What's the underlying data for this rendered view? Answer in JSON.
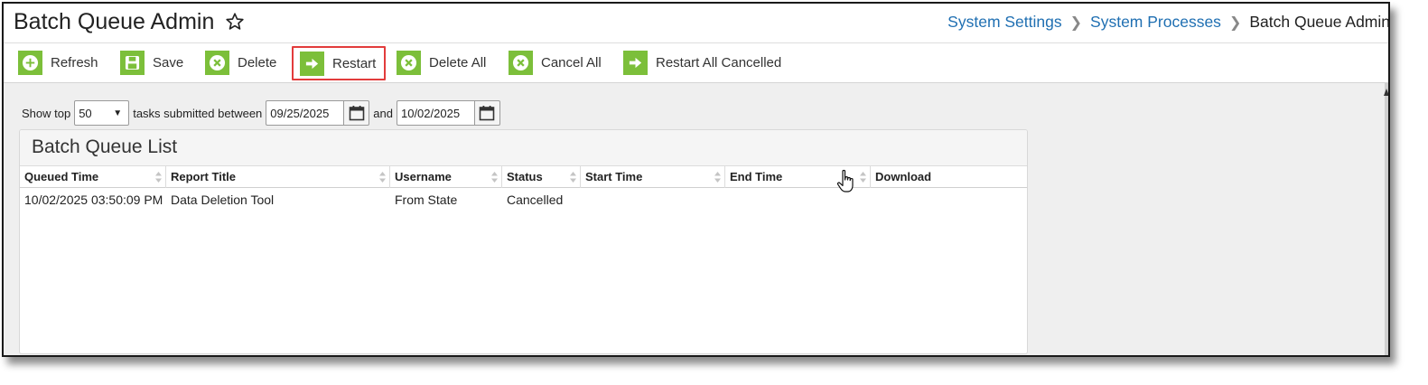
{
  "header": {
    "title": "Batch Queue Admin",
    "breadcrumb": [
      "System Settings",
      "System Processes",
      "Batch Queue Admin"
    ]
  },
  "toolbar": {
    "refresh": "Refresh",
    "save": "Save",
    "delete": "Delete",
    "restart": "Restart",
    "delete_all": "Delete All",
    "cancel_all": "Cancel All",
    "restart_all_cancelled": "Restart All Cancelled"
  },
  "filter": {
    "show_top_label": "Show top",
    "top_count": "50",
    "between_label": "tasks submitted between",
    "start_date": "09/25/2025",
    "and_label": "and",
    "end_date": "10/02/2025"
  },
  "list": {
    "title": "Batch Queue List",
    "columns": [
      "Queued Time",
      "Report Title",
      "Username",
      "Status",
      "Start Time",
      "End Time",
      "Download"
    ],
    "rows": [
      {
        "queued_time": "10/02/2025 03:50:09 PM",
        "report_title": "Data Deletion Tool",
        "username": "From State",
        "status": "Cancelled",
        "start_time": "",
        "end_time": "",
        "download": ""
      }
    ]
  },
  "icons": {
    "refresh": "plus-circle-icon",
    "save": "floppy-disk-icon",
    "delete": "x-circle-icon",
    "restart": "arrow-right-icon",
    "delete_all": "x-circle-icon",
    "cancel_all": "x-circle-icon",
    "restart_all_cancelled": "arrow-right-icon",
    "favorite": "star-outline-icon",
    "calendar": "calendar-icon",
    "cursor": "hand-pointer-icon"
  },
  "colors": {
    "accent_green": "#7cbf3a",
    "link_blue": "#1f6fb2",
    "highlight_red": "#e23c3c"
  }
}
